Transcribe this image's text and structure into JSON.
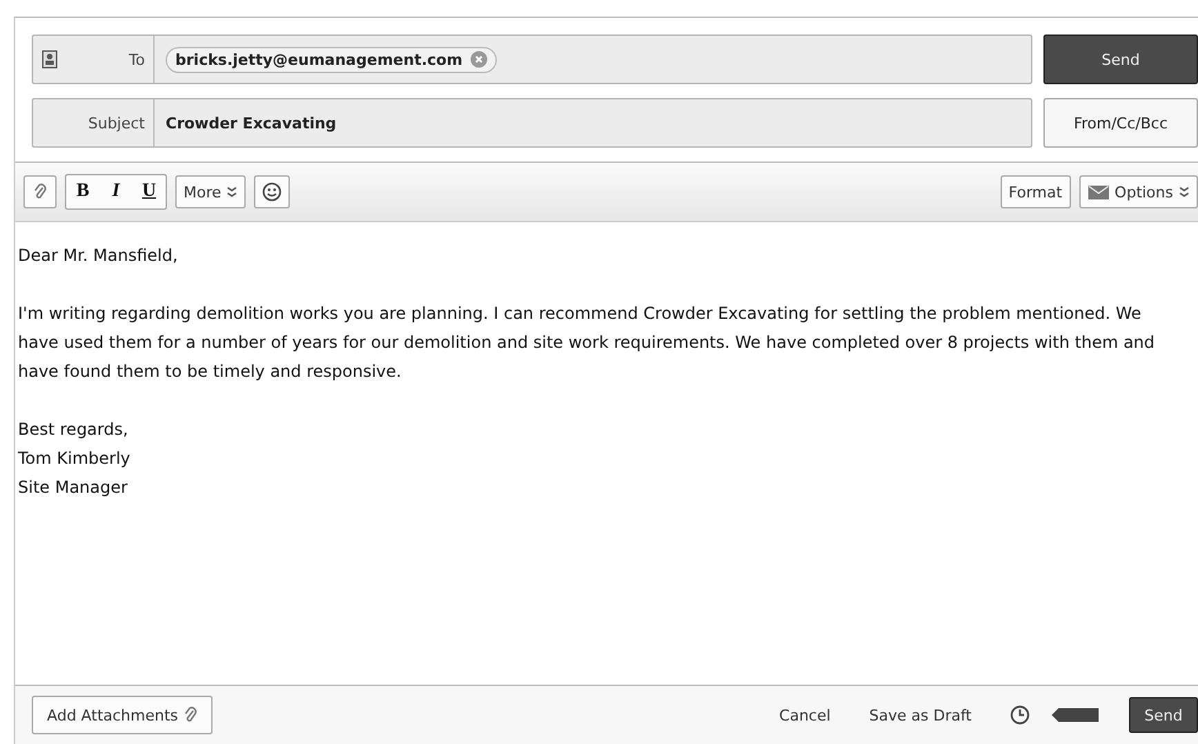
{
  "header": {
    "to_label": "To",
    "recipients": [
      "bricks.jetty@eumanagement.com"
    ],
    "subject_label": "Subject",
    "subject": "Crowder Excavating",
    "send": "Send",
    "from_cc_bcc": "From/Cc/Bcc"
  },
  "toolbar": {
    "bold": "B",
    "italic": "I",
    "underline": "U",
    "more": "More",
    "format": "Format",
    "options": "Options"
  },
  "body": {
    "greeting": "Dear Mr. Mansfield,",
    "paragraph": "I'm writing regarding demolition works you are planning. I can recommend Crowder Excavating for settling the problem mentioned. We have used them for a number of years for our demolition and site work requirements. We have completed over 8 projects with them and have found them to be timely and responsive.",
    "signature": [
      "Best regards,",
      "Tom Kimberly",
      "Site Manager"
    ]
  },
  "footer": {
    "attach": "Add Attachments",
    "cancel": "Cancel",
    "save_draft": "Save as Draft",
    "send": "Send"
  }
}
